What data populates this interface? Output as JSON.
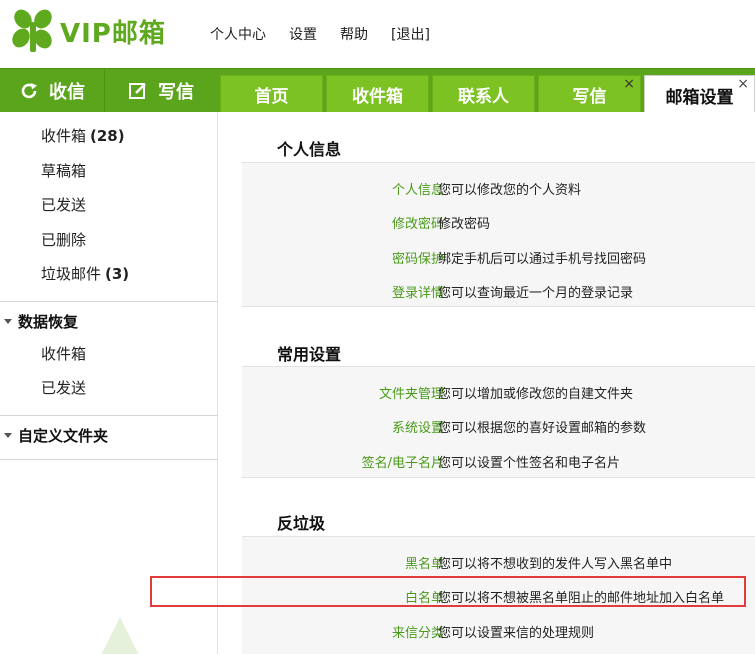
{
  "header": {
    "logo_text": "VIP邮箱",
    "links": [
      "个人中心",
      "设置",
      "帮助",
      "[退出]"
    ]
  },
  "nav": {
    "receive_label": "收信",
    "compose_label": "写信",
    "tabs": [
      {
        "label": "首页",
        "closable": false,
        "active": false
      },
      {
        "label": "收件箱",
        "closable": false,
        "active": false
      },
      {
        "label": "联系人",
        "closable": false,
        "active": false
      },
      {
        "label": "写信",
        "closable": true,
        "active": false
      },
      {
        "label": "邮箱设置",
        "closable": true,
        "active": true
      }
    ],
    "close_glyph": "×"
  },
  "sidebar": {
    "folders": [
      {
        "label": "收件箱",
        "count": "(28)"
      },
      {
        "label": "草稿箱",
        "count": ""
      },
      {
        "label": "已发送",
        "count": ""
      },
      {
        "label": "已删除",
        "count": ""
      },
      {
        "label": "垃圾邮件",
        "count": "(3)"
      }
    ],
    "recovery": {
      "title": "数据恢复",
      "items": [
        "收件箱",
        "已发送"
      ]
    },
    "custom": {
      "title": "自定义文件夹"
    }
  },
  "settings": {
    "sections": [
      {
        "title": "个人信息",
        "rows": [
          {
            "label": "个人信息",
            "desc": "您可以修改您的个人资料"
          },
          {
            "label": "修改密码",
            "desc": "修改密码"
          },
          {
            "label": "密码保护",
            "desc": "绑定手机后可以通过手机号找回密码"
          },
          {
            "label": "登录详情",
            "desc": "您可以查询最近一个月的登录记录"
          }
        ]
      },
      {
        "title": "常用设置",
        "rows": [
          {
            "label": "文件夹管理",
            "desc": "您可以增加或修改您的自建文件夹"
          },
          {
            "label": "系统设置",
            "desc": "您可以根据您的喜好设置邮箱的参数"
          },
          {
            "label": "签名/电子名片",
            "desc": "您可以设置个性签名和电子名片"
          }
        ]
      },
      {
        "title": "反垃圾",
        "rows": [
          {
            "label": "黑名单",
            "desc": "您可以将不想收到的发件人写入黑名单中"
          },
          {
            "label": "白名单",
            "desc": "您可以将不想被黑名单阻止的邮件地址加入白名单"
          },
          {
            "label": "来信分类",
            "desc": "您可以设置来信的处理规则"
          }
        ]
      }
    ]
  },
  "colors": {
    "brand_green": "#5aa51b",
    "tab_green": "#7cc222",
    "link_green": "#4a9a1a",
    "highlight_red": "#e23b3b"
  }
}
